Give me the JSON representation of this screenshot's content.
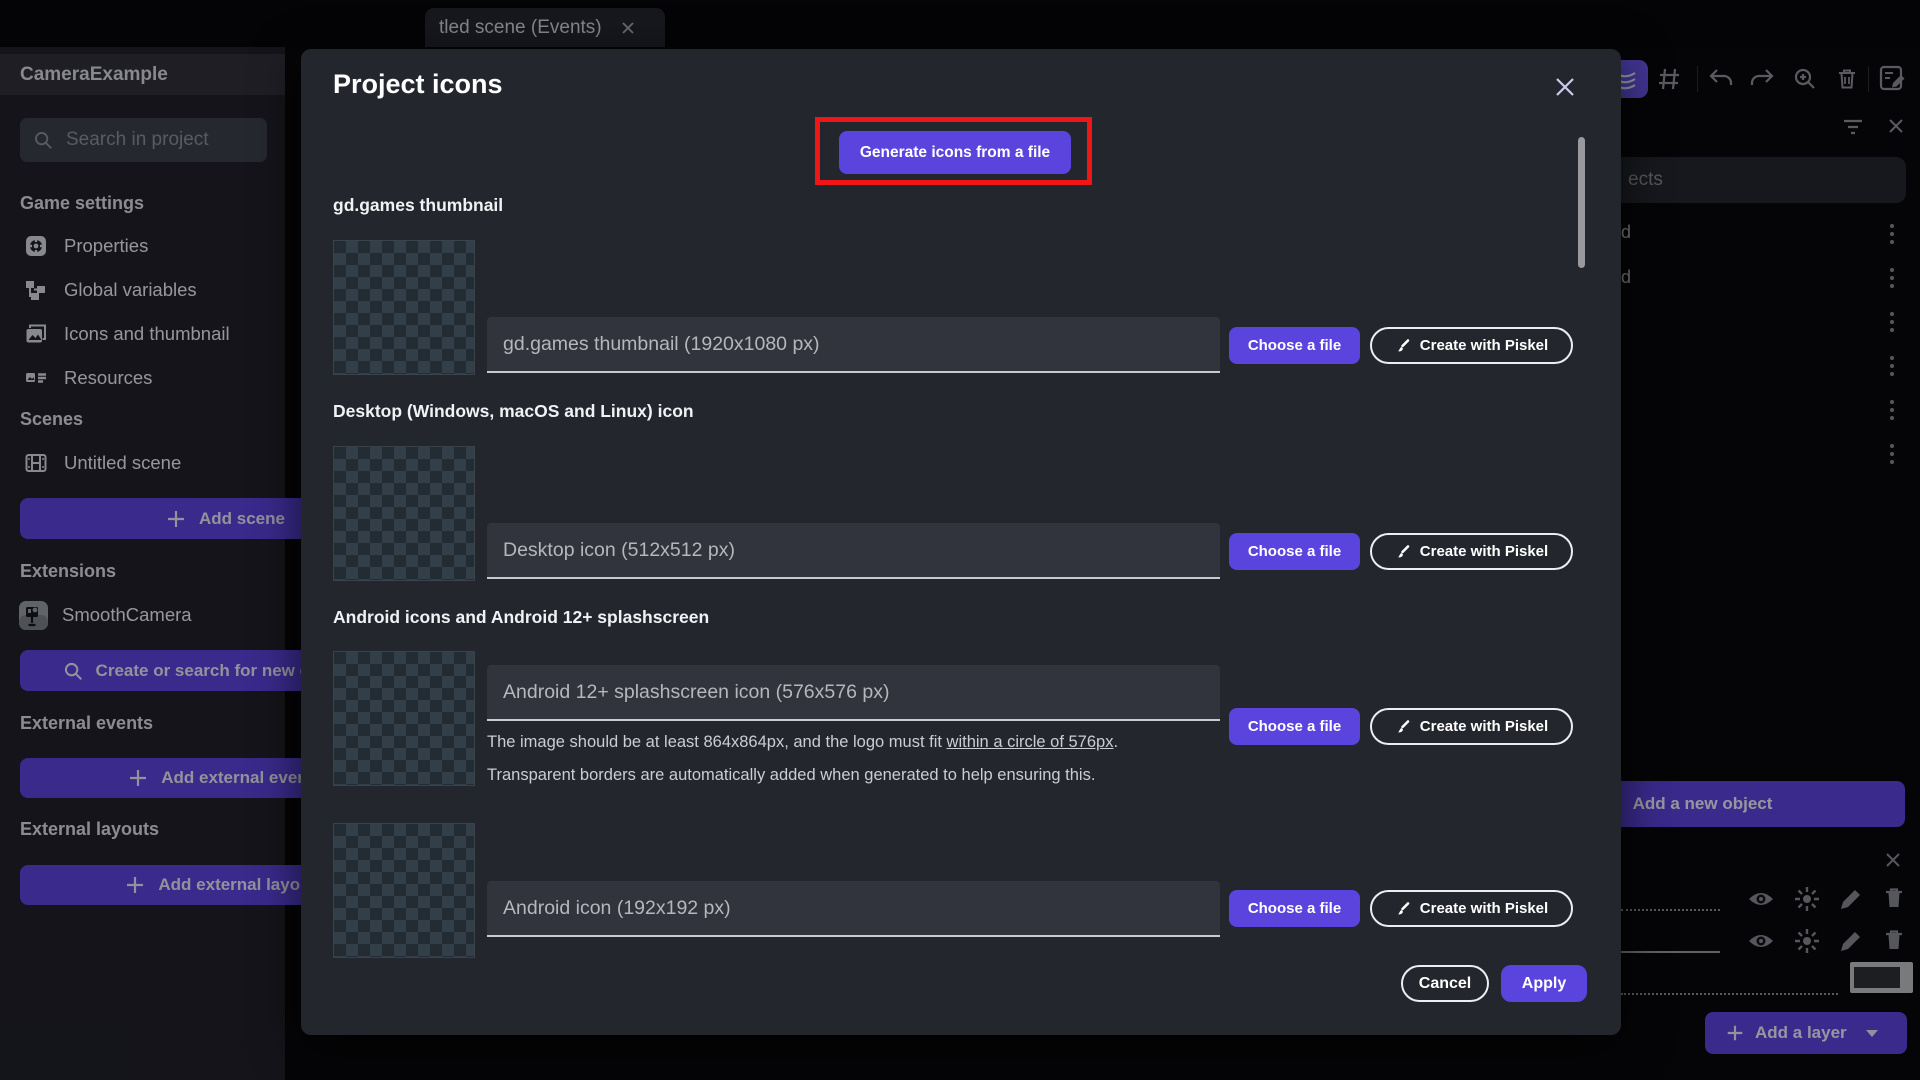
{
  "tab": {
    "title": "tled scene (Events)"
  },
  "sidebar": {
    "project_name": "CameraExample",
    "search_placeholder": "Search in project",
    "game_settings_header": "Game settings",
    "game_settings_items": [
      {
        "label": "Properties",
        "icon": "gear-square-icon"
      },
      {
        "label": "Global variables",
        "icon": "hierarchy-icon"
      },
      {
        "label": "Icons and thumbnail",
        "icon": "images-icon"
      },
      {
        "label": "Resources",
        "icon": "image-list-icon"
      }
    ],
    "scenes_header": "Scenes",
    "scene_items": [
      {
        "label": "Untitled scene",
        "icon": "film-icon"
      }
    ],
    "add_scene_label": "Add scene",
    "extensions_header": "Extensions",
    "extension_items": [
      {
        "label": "SmoothCamera",
        "icon": "camera-extension-icon"
      }
    ],
    "search_extensions_label": "Create or search for new extensions",
    "external_events_header": "External events",
    "add_external_events_label": "Add external events",
    "external_layouts_header": "External layouts",
    "add_external_layouts_label": "Add external layouts"
  },
  "modal": {
    "title": "Project icons",
    "generate_button": "Generate icons from a file",
    "choose_file_label": "Choose a file",
    "piskel_label": "Create with Piskel",
    "sections": {
      "thumbnail": {
        "header": "gd.games thumbnail",
        "field_value": "gd.games thumbnail (1920x1080 px)"
      },
      "desktop": {
        "header": "Desktop (Windows, macOS and Linux) icon",
        "field_value": "Desktop icon (512x512 px)"
      },
      "android_splash": {
        "header": "Android icons and Android 12+ splashscreen",
        "field_value": "Android 12+ splashscreen icon (576x576 px)",
        "note_part1": "The image should be at least 864x864px, and the logo must fit ",
        "note_link": "within a circle of 576px",
        "note_part2": ".",
        "note_line2": "Transparent borders are automatically added when generated to help ensuring this."
      },
      "android_icon": {
        "field_value": "Android icon (192x192 px)"
      }
    },
    "cancel_label": "Cancel",
    "apply_label": "Apply"
  },
  "right_panel": {
    "objects_title_fragment": "ects",
    "object_rows": [
      "d",
      "d"
    ],
    "add_object_label": "Add a new object",
    "add_layer_label": "Add a layer"
  },
  "icons": {
    "search": "magnifier",
    "close": "x-cross",
    "plus": "plus",
    "kebab": "vertical-ellipsis",
    "undo": "curved-arrow-left",
    "redo": "curved-arrow-right",
    "zoom_in": "magnifier-plus",
    "trash": "trash-can",
    "eye": "eye",
    "effects": "light-rays",
    "pencil": "pencil",
    "brush": "paint-brush",
    "caret_down": "triangle-down",
    "grid": "hash-grid",
    "filter": "funnel-lines"
  },
  "colors": {
    "accent": "#5b43dd",
    "highlight_red": "#ee1616",
    "modal_bg": "#24262e"
  }
}
